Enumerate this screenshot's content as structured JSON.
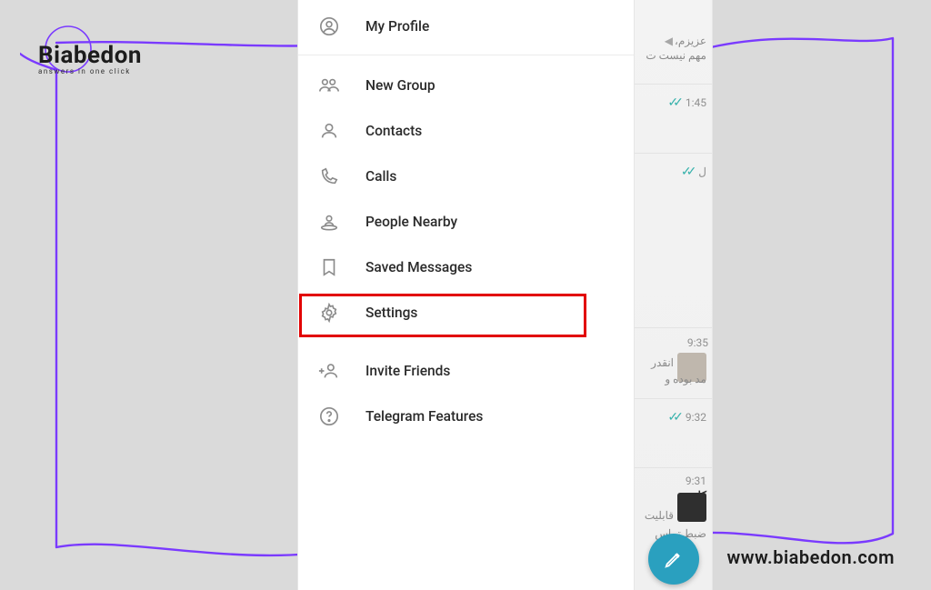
{
  "brand": {
    "name": "Biabedon",
    "tagline": "answers in one click",
    "url": "www.biabedon.com"
  },
  "menu": {
    "my_profile": "My Profile",
    "new_group": "New Group",
    "contacts": "Contacts",
    "calls": "Calls",
    "people_nearby": "People Nearby",
    "saved_messages": "Saved Messages",
    "settings": "Settings",
    "invite_friends": "Invite Friends",
    "telegram_features": "Telegram Features"
  },
  "chat": {
    "row1_text": "عزیزم،",
    "row1_sub": "مهم نیست ت",
    "time1": "1:45",
    "row2_time_approx": "ل",
    "row3_text": "انقدر",
    "row3_sub": "مد بوده و",
    "time3": "9:35",
    "time4": "9:32",
    "row5_title": "کا",
    "row5_text1": "قابلیت",
    "row5_text2": "ضبط تماس",
    "time5": "9:31"
  }
}
